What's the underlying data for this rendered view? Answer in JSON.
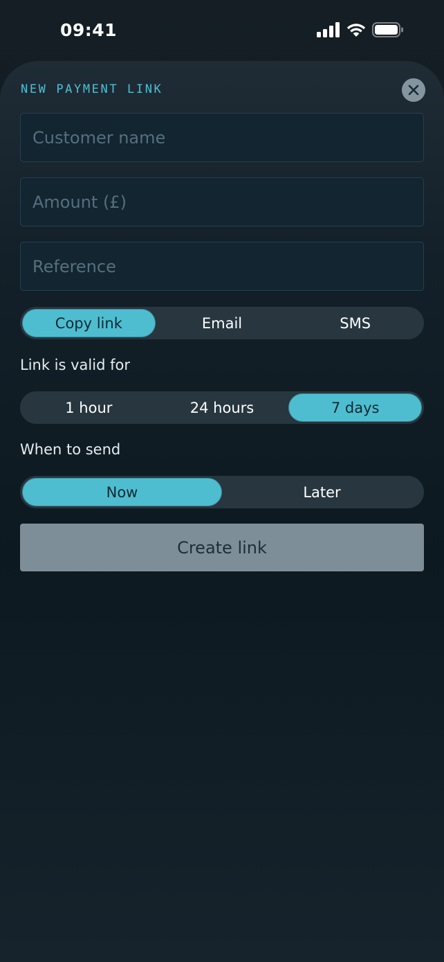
{
  "status_bar": {
    "time": "09:41",
    "icons": [
      "cellular-signal-icon",
      "wifi-icon",
      "battery-icon"
    ]
  },
  "sheet": {
    "title": "NEW PAYMENT LINK",
    "close_icon": "close-icon",
    "fields": {
      "customer_name": {
        "placeholder": "Customer name",
        "value": ""
      },
      "amount": {
        "placeholder": "Amount (£)",
        "value": ""
      },
      "reference": {
        "placeholder": "Reference",
        "value": ""
      }
    },
    "delivery": {
      "options": [
        "Copy link",
        "Email",
        "SMS"
      ],
      "selected": "Copy link"
    },
    "validity": {
      "label": "Link is valid for",
      "options": [
        "1 hour",
        "24 hours",
        "7 days"
      ],
      "selected": "7 days"
    },
    "timing": {
      "label": "When to send",
      "options": [
        "Now",
        "Later"
      ],
      "selected": "Now"
    },
    "create_button": "Create link"
  },
  "colors": {
    "accent": "#4fbdd0",
    "title": "#4fc0d4",
    "button_disabled": "#7e8e98",
    "segment_bg": "#27363f"
  }
}
